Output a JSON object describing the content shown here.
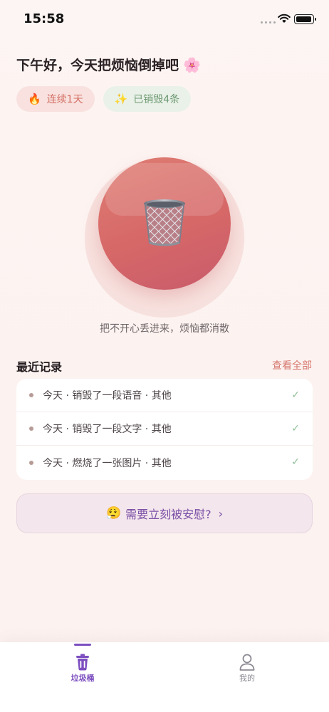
{
  "status_bar": {
    "time": "15:58"
  },
  "greeting": {
    "text": "下午好，今天把烦恼倒掉吧",
    "emoji": "🌸"
  },
  "chips": {
    "streak": {
      "icon": "🔥",
      "label": "连续1天"
    },
    "destroyed": {
      "icon": "✨",
      "label": "已销毁4条"
    }
  },
  "trash": {
    "hint": "把不开心丢进来，烦恼都消散"
  },
  "recent": {
    "title": "最近记录",
    "view_all": "查看全部",
    "items": [
      {
        "text": "今天 · 销毁了一段语音 · 其他",
        "check": "✓"
      },
      {
        "text": "今天 · 销毁了一段文字 · 其他",
        "check": "✓"
      },
      {
        "text": "今天 · 燃烧了一张图片 · 其他",
        "check": "✓"
      }
    ]
  },
  "comfort": {
    "emoji": "😮‍💨",
    "label": "需要立刻被安慰?",
    "chevron": "›"
  },
  "tab_bar": {
    "tabs": [
      {
        "label": "垃圾桶",
        "icon": "trash-icon",
        "active": true
      },
      {
        "label": "我的",
        "icon": "person-icon",
        "active": false
      }
    ]
  },
  "colors": {
    "accent": "#7d4fc0",
    "primary_red": "#d66868",
    "background": "#fcf3f1"
  }
}
